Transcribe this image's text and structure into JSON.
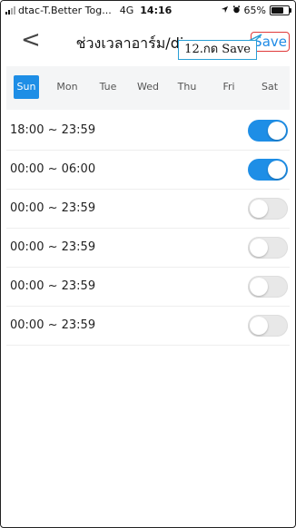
{
  "status_bar": {
    "carrier": "dtac-T.Better Tog...",
    "network": "4G",
    "time": "14:16",
    "battery": "65%",
    "battery_level": 0.65
  },
  "nav": {
    "title": "ช่วงเวลาอาร์ม/disarm",
    "back_label": "<",
    "save_label": "Save"
  },
  "annotation": {
    "callout_text": "12.กด Save",
    "accent_color": "#2a9fd6",
    "highlight_color": "#e03a3a"
  },
  "days": {
    "items": [
      "Sun",
      "Mon",
      "Tue",
      "Wed",
      "Thu",
      "Fri",
      "Sat"
    ],
    "selected": "Sun",
    "accent_color": "#1e8ee6"
  },
  "schedule": [
    {
      "range": "18:00 ~ 23:59",
      "enabled": true
    },
    {
      "range": "00:00 ~ 06:00",
      "enabled": true
    },
    {
      "range": "00:00 ~ 23:59",
      "enabled": false
    },
    {
      "range": "00:00 ~ 23:59",
      "enabled": false
    },
    {
      "range": "00:00 ~ 23:59",
      "enabled": false
    },
    {
      "range": "00:00 ~ 23:59",
      "enabled": false
    }
  ]
}
